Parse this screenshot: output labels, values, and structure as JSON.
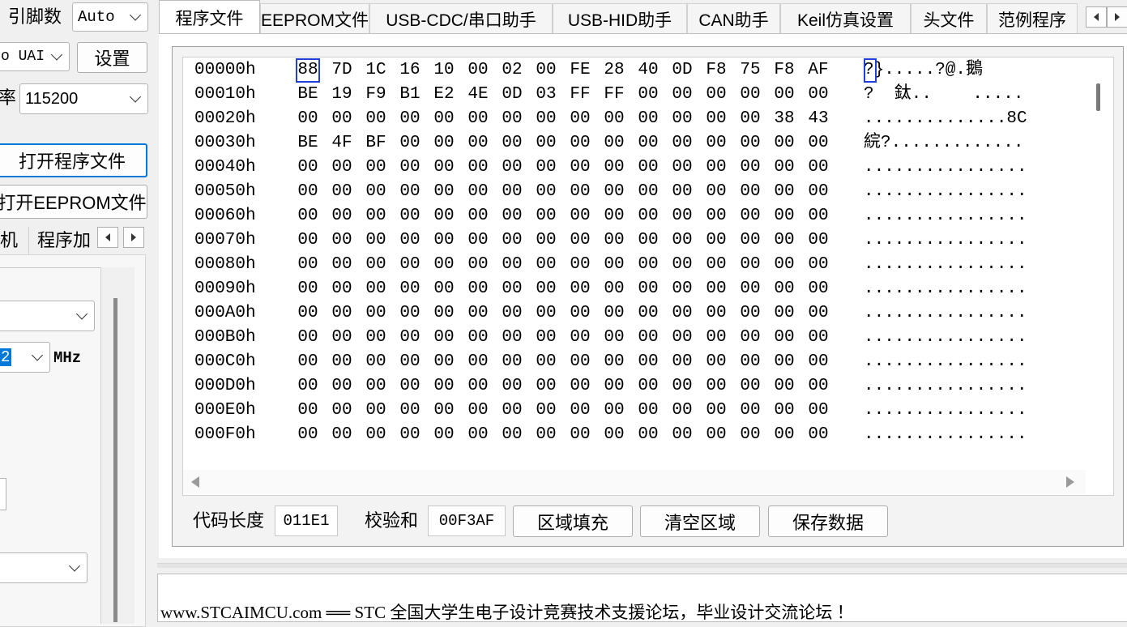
{
  "left": {
    "pin_label": "引脚数",
    "pin_value": "Auto",
    "port_value": "o UAI",
    "settings_button": "设置",
    "baud_label": "率",
    "baud_value": "115200",
    "open_program_button": "打开程序文件",
    "open_eeprom_button": "打开EEPROM文件",
    "subtab1": "机",
    "subtab2": "程序加",
    "freq_value": "2",
    "freq_unit": "MHz"
  },
  "tabs": [
    {
      "label": "程序文件",
      "active": true
    },
    {
      "label": "EEPROM文件",
      "active": false
    },
    {
      "label": "USB-CDC/串口助手",
      "active": false
    },
    {
      "label": "USB-HID助手",
      "active": false
    },
    {
      "label": "CAN助手",
      "active": false
    },
    {
      "label": "Keil仿真设置",
      "active": false
    },
    {
      "label": "头文件",
      "active": false
    },
    {
      "label": "范例程序",
      "active": false
    }
  ],
  "hex": {
    "rows": [
      {
        "addr": "00000h",
        "bytes": [
          "88",
          "7D",
          "1C",
          "16",
          "10",
          "00",
          "02",
          "00",
          "FE",
          "28",
          "40",
          "0D",
          "F8",
          "75",
          "F8",
          "AF"
        ],
        "ascii": "?}.....?@.鵝"
      },
      {
        "addr": "00010h",
        "bytes": [
          "BE",
          "19",
          "F9",
          "B1",
          "E2",
          "4E",
          "0D",
          "03",
          "FF",
          "FF",
          "00",
          "00",
          "00",
          "00",
          "00",
          "00"
        ],
        "ascii": "?  鈦..    ....."
      },
      {
        "addr": "00020h",
        "bytes": [
          "00",
          "00",
          "00",
          "00",
          "00",
          "00",
          "00",
          "00",
          "00",
          "00",
          "00",
          "00",
          "00",
          "00",
          "38",
          "43"
        ],
        "ascii": "..............8C"
      },
      {
        "addr": "00030h",
        "bytes": [
          "BE",
          "4F",
          "BF",
          "00",
          "00",
          "00",
          "00",
          "00",
          "00",
          "00",
          "00",
          "00",
          "00",
          "00",
          "00",
          "00"
        ],
        "ascii": "綄?............."
      },
      {
        "addr": "00040h",
        "bytes": [
          "00",
          "00",
          "00",
          "00",
          "00",
          "00",
          "00",
          "00",
          "00",
          "00",
          "00",
          "00",
          "00",
          "00",
          "00",
          "00"
        ],
        "ascii": "................"
      },
      {
        "addr": "00050h",
        "bytes": [
          "00",
          "00",
          "00",
          "00",
          "00",
          "00",
          "00",
          "00",
          "00",
          "00",
          "00",
          "00",
          "00",
          "00",
          "00",
          "00"
        ],
        "ascii": "................"
      },
      {
        "addr": "00060h",
        "bytes": [
          "00",
          "00",
          "00",
          "00",
          "00",
          "00",
          "00",
          "00",
          "00",
          "00",
          "00",
          "00",
          "00",
          "00",
          "00",
          "00"
        ],
        "ascii": "................"
      },
      {
        "addr": "00070h",
        "bytes": [
          "00",
          "00",
          "00",
          "00",
          "00",
          "00",
          "00",
          "00",
          "00",
          "00",
          "00",
          "00",
          "00",
          "00",
          "00",
          "00"
        ],
        "ascii": "................"
      },
      {
        "addr": "00080h",
        "bytes": [
          "00",
          "00",
          "00",
          "00",
          "00",
          "00",
          "00",
          "00",
          "00",
          "00",
          "00",
          "00",
          "00",
          "00",
          "00",
          "00"
        ],
        "ascii": "................"
      },
      {
        "addr": "00090h",
        "bytes": [
          "00",
          "00",
          "00",
          "00",
          "00",
          "00",
          "00",
          "00",
          "00",
          "00",
          "00",
          "00",
          "00",
          "00",
          "00",
          "00"
        ],
        "ascii": "................"
      },
      {
        "addr": "000A0h",
        "bytes": [
          "00",
          "00",
          "00",
          "00",
          "00",
          "00",
          "00",
          "00",
          "00",
          "00",
          "00",
          "00",
          "00",
          "00",
          "00",
          "00"
        ],
        "ascii": "................"
      },
      {
        "addr": "000B0h",
        "bytes": [
          "00",
          "00",
          "00",
          "00",
          "00",
          "00",
          "00",
          "00",
          "00",
          "00",
          "00",
          "00",
          "00",
          "00",
          "00",
          "00"
        ],
        "ascii": "................"
      },
      {
        "addr": "000C0h",
        "bytes": [
          "00",
          "00",
          "00",
          "00",
          "00",
          "00",
          "00",
          "00",
          "00",
          "00",
          "00",
          "00",
          "00",
          "00",
          "00",
          "00"
        ],
        "ascii": "................"
      },
      {
        "addr": "000D0h",
        "bytes": [
          "00",
          "00",
          "00",
          "00",
          "00",
          "00",
          "00",
          "00",
          "00",
          "00",
          "00",
          "00",
          "00",
          "00",
          "00",
          "00"
        ],
        "ascii": "................"
      },
      {
        "addr": "000E0h",
        "bytes": [
          "00",
          "00",
          "00",
          "00",
          "00",
          "00",
          "00",
          "00",
          "00",
          "00",
          "00",
          "00",
          "00",
          "00",
          "00",
          "00"
        ],
        "ascii": "................"
      },
      {
        "addr": "000F0h",
        "bytes": [
          "00",
          "00",
          "00",
          "00",
          "00",
          "00",
          "00",
          "00",
          "00",
          "00",
          "00",
          "00",
          "00",
          "00",
          "00",
          "00"
        ],
        "ascii": "................"
      }
    ]
  },
  "bottom": {
    "code_length_label": "代码长度",
    "code_length_value": "011E1",
    "checksum_label": "校验和",
    "checksum_value": "00F3AF",
    "fill_button": "区域填充",
    "clear_button": "清空区域",
    "save_button": "保存数据"
  },
  "log": {
    "text": "www.STCAIMCU.com ══ STC 全国大学生电子设计竞赛技术支援论坛，毕业设计交流论坛 ！"
  }
}
